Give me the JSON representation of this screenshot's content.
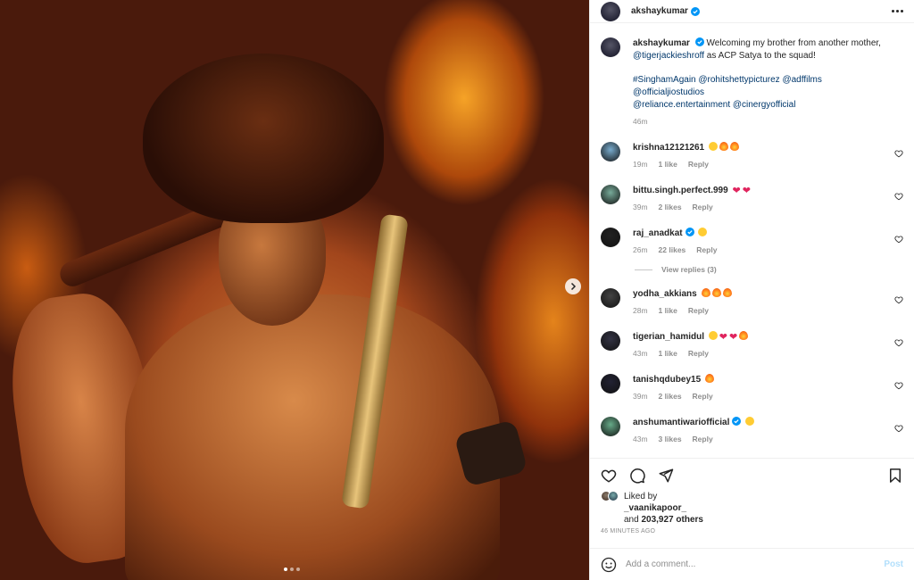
{
  "post": {
    "author": "akshaykumar",
    "caption_line1": "Welcoming my brother from another mother,",
    "caption_mention": "@tigerjackieshroff",
    "caption_rest": " as ACP Satya to the squad!",
    "tags_line1": "#SinghamAgain @rohitshettypicturez @adffilms",
    "tags_line2": "@officialjiostudios",
    "tags_line3": "@reliance.entertainment @cinergyofficial",
    "caption_time": "46m"
  },
  "comments": [
    {
      "user": "krishna12121261",
      "time": "19m",
      "likes": "1 like",
      "reply": "Reply",
      "emojis": [
        "smile",
        "fire",
        "fire"
      ]
    },
    {
      "user": "bittu.singh.perfect.999",
      "time": "39m",
      "likes": "2 likes",
      "reply": "Reply",
      "emojis": [
        "heart",
        "heart"
      ]
    },
    {
      "user": "raj_anadkat",
      "time": "26m",
      "likes": "22 likes",
      "reply": "Reply",
      "verified": true,
      "emojis": [
        "smile"
      ]
    },
    {
      "user": "yodha_akkians",
      "time": "28m",
      "likes": "1 like",
      "reply": "Reply",
      "emojis": [
        "fire",
        "fire",
        "fire"
      ]
    },
    {
      "user": "tigerian_hamidul",
      "time": "43m",
      "likes": "1 like",
      "reply": "Reply",
      "emojis": [
        "smile",
        "heart",
        "heart",
        "fire"
      ]
    },
    {
      "user": "tanishqdubey15",
      "time": "39m",
      "likes": "2 likes",
      "reply": "Reply",
      "emojis": [
        "fire"
      ]
    },
    {
      "user": "anshumantiwariofficial",
      "time": "43m",
      "likes": "3 likes",
      "reply": "Reply",
      "verified": true,
      "emojis": [
        "smile"
      ]
    }
  ],
  "view_replies": "View replies (3)",
  "likes": {
    "liked_by_label": "Liked by",
    "liked_by_user": "_vaanikapoor_",
    "and_label": "and",
    "others": "203,927 others",
    "time_ago": "46 MINUTES AGO"
  },
  "add_comment": {
    "placeholder": "Add a comment...",
    "post_label": "Post"
  },
  "colors": {
    "verified": "#0095f6",
    "link": "#00376b",
    "heart": "#e0245e"
  }
}
